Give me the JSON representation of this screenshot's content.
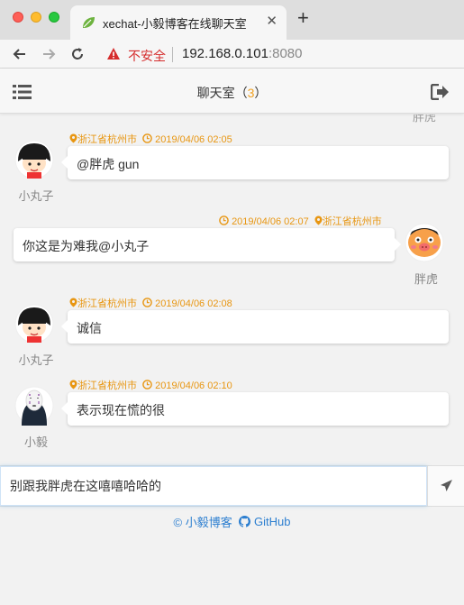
{
  "browser": {
    "tab_title": "xechat-小毅博客在线聊天室",
    "security_label": "不安全",
    "url_host": "192.168.0.101",
    "url_port": ":8080"
  },
  "header": {
    "title": "聊天室",
    "count": "3",
    "paren_open": "（",
    "paren_close": "）"
  },
  "chat": {
    "cutoff_name": "胖虎",
    "messages": [
      {
        "name": "小丸子",
        "location": "浙江省杭州市",
        "time": "2019/04/06 02:05",
        "text": "@胖虎 gun",
        "side": "left"
      },
      {
        "name": "胖虎",
        "location": "浙江省杭州市",
        "time": "2019/04/06 02:07",
        "text": "你这是为难我@小丸子",
        "side": "right"
      },
      {
        "name": "小丸子",
        "location": "浙江省杭州市",
        "time": "2019/04/06 02:08",
        "text": "诚信",
        "side": "left"
      },
      {
        "name": "小毅",
        "location": "浙江省杭州市",
        "time": "2019/04/06 02:10",
        "text": "表示现在慌的很",
        "side": "left"
      }
    ]
  },
  "input": {
    "value": "别跟我胖虎在这嘻嘻哈哈的"
  },
  "footer": {
    "copyright": "© 小毅博客",
    "github": "GitHub"
  },
  "colors": {
    "accent_orange": "#e89611",
    "link_blue": "#2d7fd0",
    "warning_red": "#d52d2d"
  }
}
